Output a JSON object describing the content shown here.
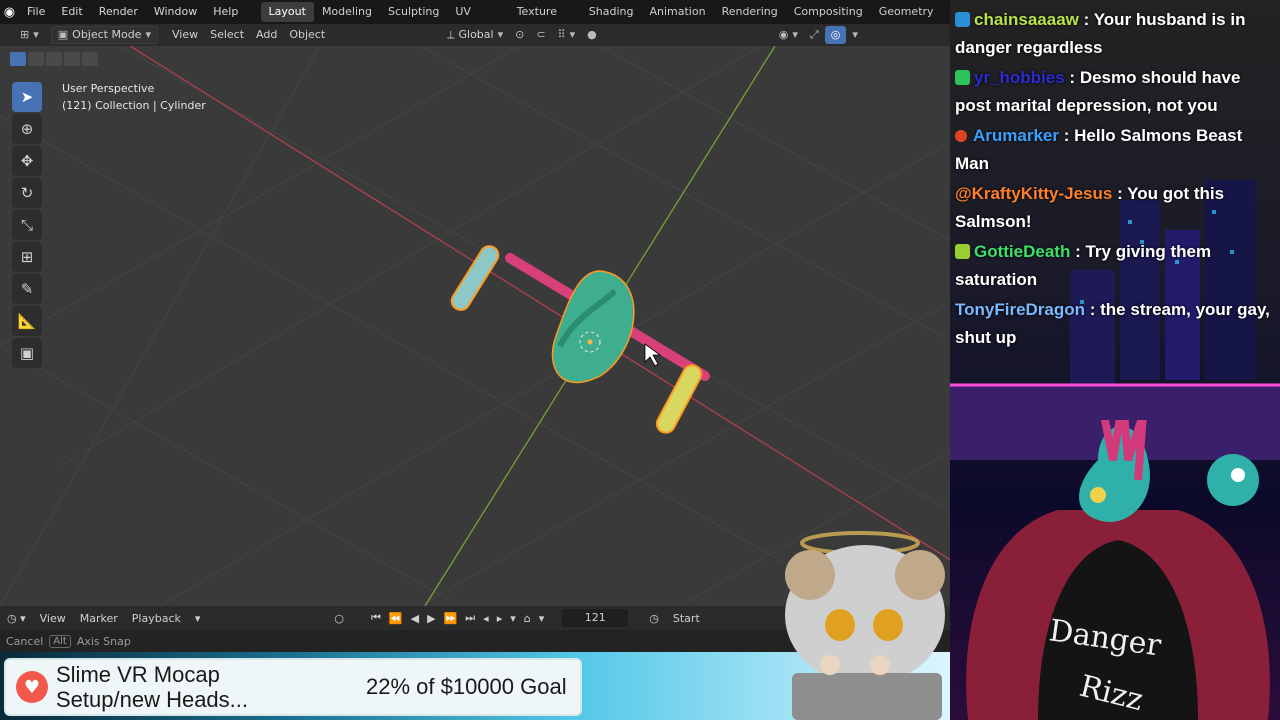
{
  "topbar": {
    "menus": [
      "File",
      "Edit",
      "Render",
      "Window",
      "Help"
    ],
    "workspaces": [
      "Layout",
      "Modeling",
      "Sculpting",
      "UV Editing",
      "Texture Paint",
      "Shading",
      "Animation",
      "Rendering",
      "Compositing",
      "Geometry Nodes"
    ],
    "active_workspace": "Layout"
  },
  "viewport_header": {
    "mode": "Object Mode",
    "menus": [
      "View",
      "Select",
      "Add",
      "Object"
    ],
    "transform_orientation": "Global"
  },
  "viewport": {
    "perspective_label": "User Perspective",
    "collection_label": "(121) Collection | Cylinder"
  },
  "timeline": {
    "menus": [
      "View",
      "Marker",
      "Playback"
    ],
    "current_frame": "121",
    "start_label": "Start"
  },
  "statusbar": {
    "cancel": "Cancel",
    "alt_key": "Alt",
    "axis_snap": "Axis Snap"
  },
  "goal": {
    "title_line1": "Slime VR Mocap",
    "title_line2": "Setup/new Heads...",
    "progress": "22% of $10000 Goal"
  },
  "chat": [
    {
      "user": "chainsaaaaw",
      "user_color": "#b6e34a",
      "text": "Your husband is in danger regardless",
      "badge": "#2a8fd6"
    },
    {
      "user": "yr_hobbies",
      "user_color": "#2b2bd0",
      "text": "Desmo should have post marital depression, not you",
      "badge": "#2ec25a"
    },
    {
      "user": "Arumarker",
      "user_color": "#3aa0ff",
      "text": "Hello Salmons Beast Man",
      "badge": "#e0441f"
    },
    {
      "user": "@KraftyKitty-Jesus",
      "user_color": "#ff7f2a",
      "text": "You got this Salmson!",
      "badge": ""
    },
    {
      "user": "GottieDeath",
      "user_color": "#3ce06a",
      "text": "Try giving them saturation",
      "badge": "#9acd32"
    },
    {
      "user": "TonyFireDragon",
      "user_color": "#7ab8ff",
      "text": "the stream, your gay, shut up",
      "badge": ""
    }
  ],
  "avatar": {
    "shirt_text_line1": "Danger",
    "shirt_text_line2": "Rizz"
  },
  "colors": {
    "accent": "#4772b3",
    "x_axis": "#c8424e",
    "y_axis": "#8bc34a",
    "object_fill": "#3fae8f",
    "object_outline": "#ff9a1f"
  }
}
